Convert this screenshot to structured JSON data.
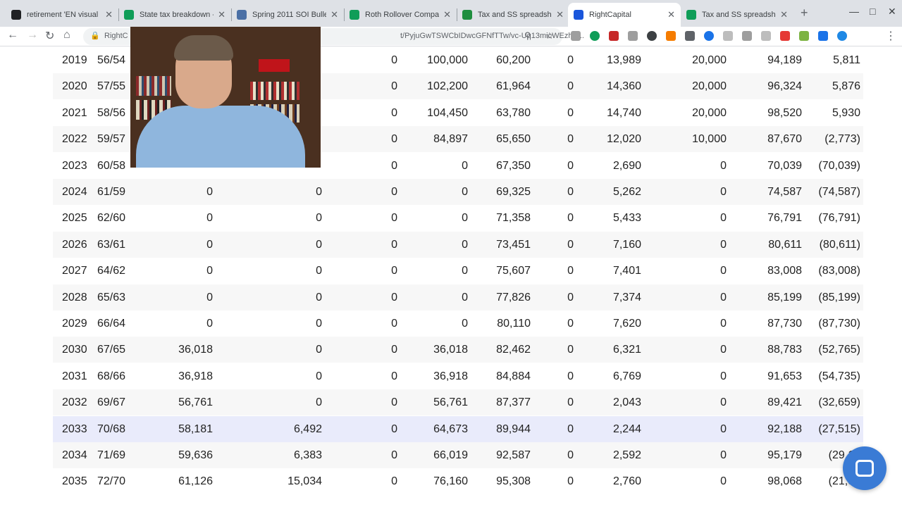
{
  "tabs": [
    {
      "title": "retirement 'EN visual ...",
      "color": "#202124",
      "icon": "github-icon"
    },
    {
      "title": "State tax breakdown - ...",
      "color": "#0f9d58",
      "icon": "sheets-icon"
    },
    {
      "title": "Spring 2011 SOI Bulleti...",
      "color": "#4a6fa5",
      "icon": "irs-icon"
    },
    {
      "title": "Roth Rollover Compari...",
      "color": "#0f9d58",
      "icon": "sheets-icon"
    },
    {
      "title": "Tax and SS spreadshe...",
      "color": "#1e8e3e",
      "icon": "excel-icon"
    },
    {
      "title": "RightCapital",
      "color": "#1a56db",
      "icon": "rightcapital-icon",
      "active": true
    },
    {
      "title": "Tax and SS spreadshe...",
      "color": "#0f9d58",
      "icon": "sheets-icon"
    }
  ],
  "toolbar": {
    "site_label": "RightC",
    "url_tail": "t/PyjuGwTSWCbIDwcGFNfTTw/vc-Uq13micWEzhE..."
  },
  "table": {
    "highlight_year": "2033",
    "rows": [
      [
        "2019",
        "56/54",
        "",
        "",
        "0",
        "100,000",
        "60,200",
        "0",
        "13,989",
        "20,000",
        "94,189",
        "5,811"
      ],
      [
        "2020",
        "57/55",
        "",
        "",
        "0",
        "102,200",
        "61,964",
        "0",
        "14,360",
        "20,000",
        "96,324",
        "5,876"
      ],
      [
        "2021",
        "58/56",
        "",
        "",
        "0",
        "104,450",
        "63,780",
        "0",
        "14,740",
        "20,000",
        "98,520",
        "5,930"
      ],
      [
        "2022",
        "59/57",
        "",
        "",
        "0",
        "84,897",
        "65,650",
        "0",
        "12,020",
        "10,000",
        "87,670",
        "(2,773)"
      ],
      [
        "2023",
        "60/58",
        "",
        "",
        "0",
        "0",
        "67,350",
        "0",
        "2,690",
        "0",
        "70,039",
        "(70,039)"
      ],
      [
        "2024",
        "61/59",
        "0",
        "0",
        "0",
        "0",
        "69,325",
        "0",
        "5,262",
        "0",
        "74,587",
        "(74,587)"
      ],
      [
        "2025",
        "62/60",
        "0",
        "0",
        "0",
        "0",
        "71,358",
        "0",
        "5,433",
        "0",
        "76,791",
        "(76,791)"
      ],
      [
        "2026",
        "63/61",
        "0",
        "0",
        "0",
        "0",
        "73,451",
        "0",
        "7,160",
        "0",
        "80,611",
        "(80,611)"
      ],
      [
        "2027",
        "64/62",
        "0",
        "0",
        "0",
        "0",
        "75,607",
        "0",
        "7,401",
        "0",
        "83,008",
        "(83,008)"
      ],
      [
        "2028",
        "65/63",
        "0",
        "0",
        "0",
        "0",
        "77,826",
        "0",
        "7,374",
        "0",
        "85,199",
        "(85,199)"
      ],
      [
        "2029",
        "66/64",
        "0",
        "0",
        "0",
        "0",
        "80,110",
        "0",
        "7,620",
        "0",
        "87,730",
        "(87,730)"
      ],
      [
        "2030",
        "67/65",
        "36,018",
        "0",
        "0",
        "36,018",
        "82,462",
        "0",
        "6,321",
        "0",
        "88,783",
        "(52,765)"
      ],
      [
        "2031",
        "68/66",
        "36,918",
        "0",
        "0",
        "36,918",
        "84,884",
        "0",
        "6,769",
        "0",
        "91,653",
        "(54,735)"
      ],
      [
        "2032",
        "69/67",
        "56,761",
        "0",
        "0",
        "56,761",
        "87,377",
        "0",
        "2,043",
        "0",
        "89,421",
        "(32,659)"
      ],
      [
        "2033",
        "70/68",
        "58,181",
        "6,492",
        "0",
        "64,673",
        "89,944",
        "0",
        "2,244",
        "0",
        "92,188",
        "(27,515)"
      ],
      [
        "2034",
        "71/69",
        "59,636",
        "6,383",
        "0",
        "66,019",
        "92,587",
        "0",
        "2,592",
        "0",
        "95,179",
        "(29,16"
      ],
      [
        "2035",
        "72/70",
        "61,126",
        "15,034",
        "0",
        "76,160",
        "95,308",
        "0",
        "2,760",
        "0",
        "98,068",
        "(21,90"
      ]
    ]
  }
}
